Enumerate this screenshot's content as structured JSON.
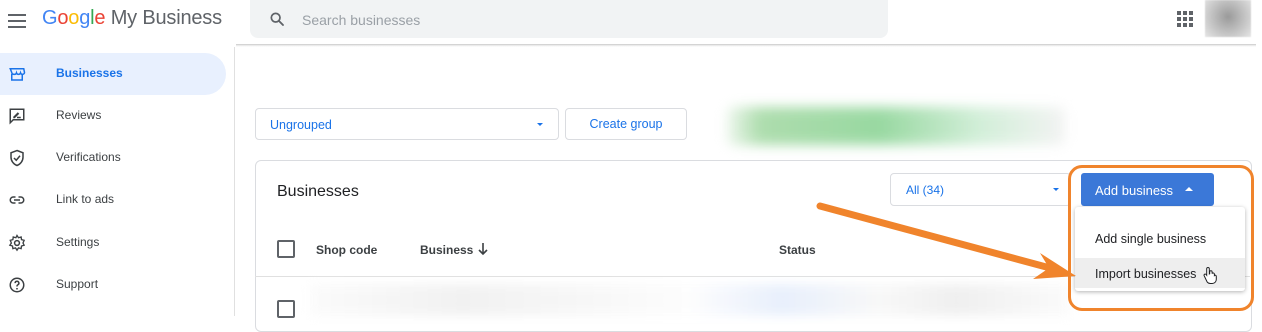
{
  "header": {
    "logo_google": "Google",
    "logo_product": "My Business",
    "search_placeholder": "Search businesses"
  },
  "sidebar": {
    "items": [
      {
        "label": "Businesses",
        "icon": "storefront-icon",
        "active": true
      },
      {
        "label": "Reviews",
        "icon": "review-icon"
      },
      {
        "label": "Verifications",
        "icon": "shield-check-icon"
      },
      {
        "label": "Link to ads",
        "icon": "link-icon"
      },
      {
        "label": "Settings",
        "icon": "gear-icon"
      },
      {
        "label": "Support",
        "icon": "help-icon"
      }
    ]
  },
  "toolbar": {
    "group_select_value": "Ungrouped",
    "create_group_label": "Create group"
  },
  "card": {
    "title": "Businesses",
    "filter_value": "All (34)",
    "add_business_label": "Add business"
  },
  "table": {
    "columns": [
      "Shop code",
      "Business",
      "Status"
    ]
  },
  "add_menu": {
    "items": [
      "Add single business",
      "Import businesses"
    ]
  },
  "colors": {
    "accent": "#1a73e8",
    "primary_button": "#3b78d8",
    "annotation": "#f0842c",
    "active_nav_bg": "#e8f0fe"
  }
}
